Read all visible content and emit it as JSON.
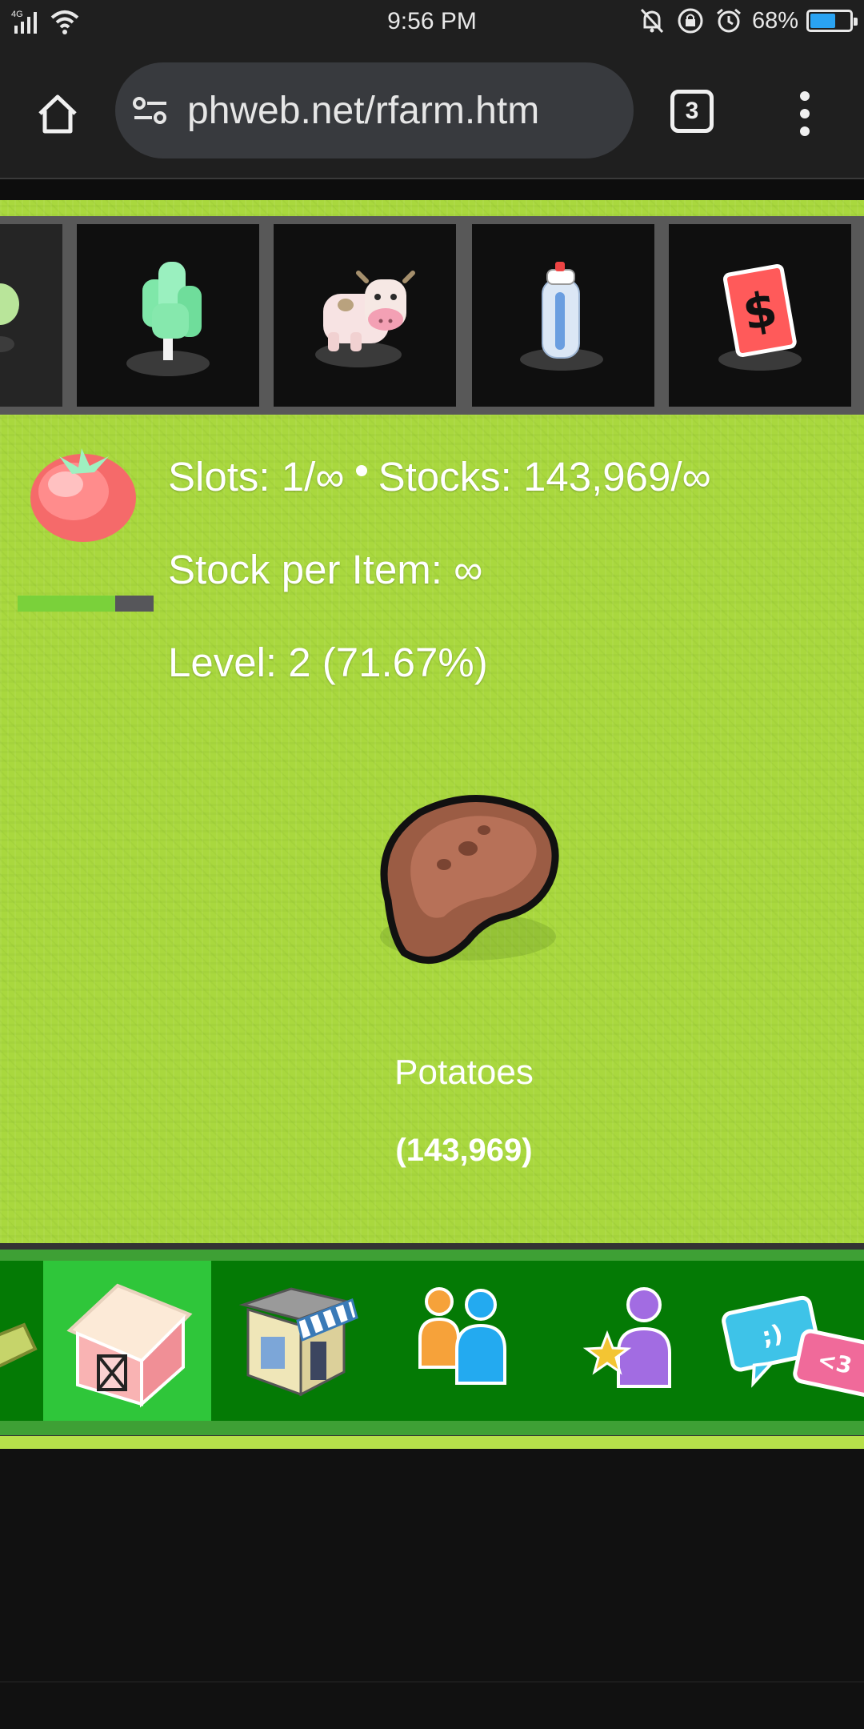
{
  "status_bar": {
    "network": "4G",
    "time": "9:56 PM",
    "battery_percent": "68%",
    "battery_level": 0.68,
    "icons": [
      "signal-icon",
      "wifi-icon",
      "mute-icon",
      "lock-rotation-icon",
      "alarm-icon",
      "battery-icon"
    ]
  },
  "browser": {
    "url": "phweb.net/rfarm.htm",
    "tab_count": "3",
    "icons": [
      "home-icon",
      "site-settings-icon",
      "tabs-icon",
      "more-menu-icon"
    ]
  },
  "toolbar": {
    "items": [
      {
        "name": "partial-item",
        "icon": "plant-icon"
      },
      {
        "name": "trees",
        "icon": "tree-icon"
      },
      {
        "name": "animals",
        "icon": "cow-icon"
      },
      {
        "name": "spray",
        "icon": "spray-can-icon"
      },
      {
        "name": "sell",
        "icon": "dollar-card-icon"
      }
    ]
  },
  "stats": {
    "slots": "Slots: 1/∞",
    "stocks": "Stocks: 143,969/∞",
    "stock_per_item": "Stock per Item: ∞",
    "level": "Level: 2 (71.67%)",
    "level_progress": 0.7167,
    "product_icon": "tomato-icon"
  },
  "selected_item": {
    "name": "Potatoes",
    "count": "(143,969)",
    "icon": "potato-icon"
  },
  "nav": {
    "items": [
      {
        "name": "partial-nav",
        "icon": "map-icon"
      },
      {
        "name": "barn",
        "icon": "barn-icon",
        "active": true
      },
      {
        "name": "shop",
        "icon": "shop-icon"
      },
      {
        "name": "friends",
        "icon": "friends-icon"
      },
      {
        "name": "profile",
        "icon": "star-user-icon"
      },
      {
        "name": "chat",
        "icon": "chat-icon"
      }
    ]
  },
  "colors": {
    "grass": "#a9d83e",
    "nav_green": "#047a05",
    "nav_active": "#2fc63a",
    "toolbar_bg": "#585858"
  }
}
